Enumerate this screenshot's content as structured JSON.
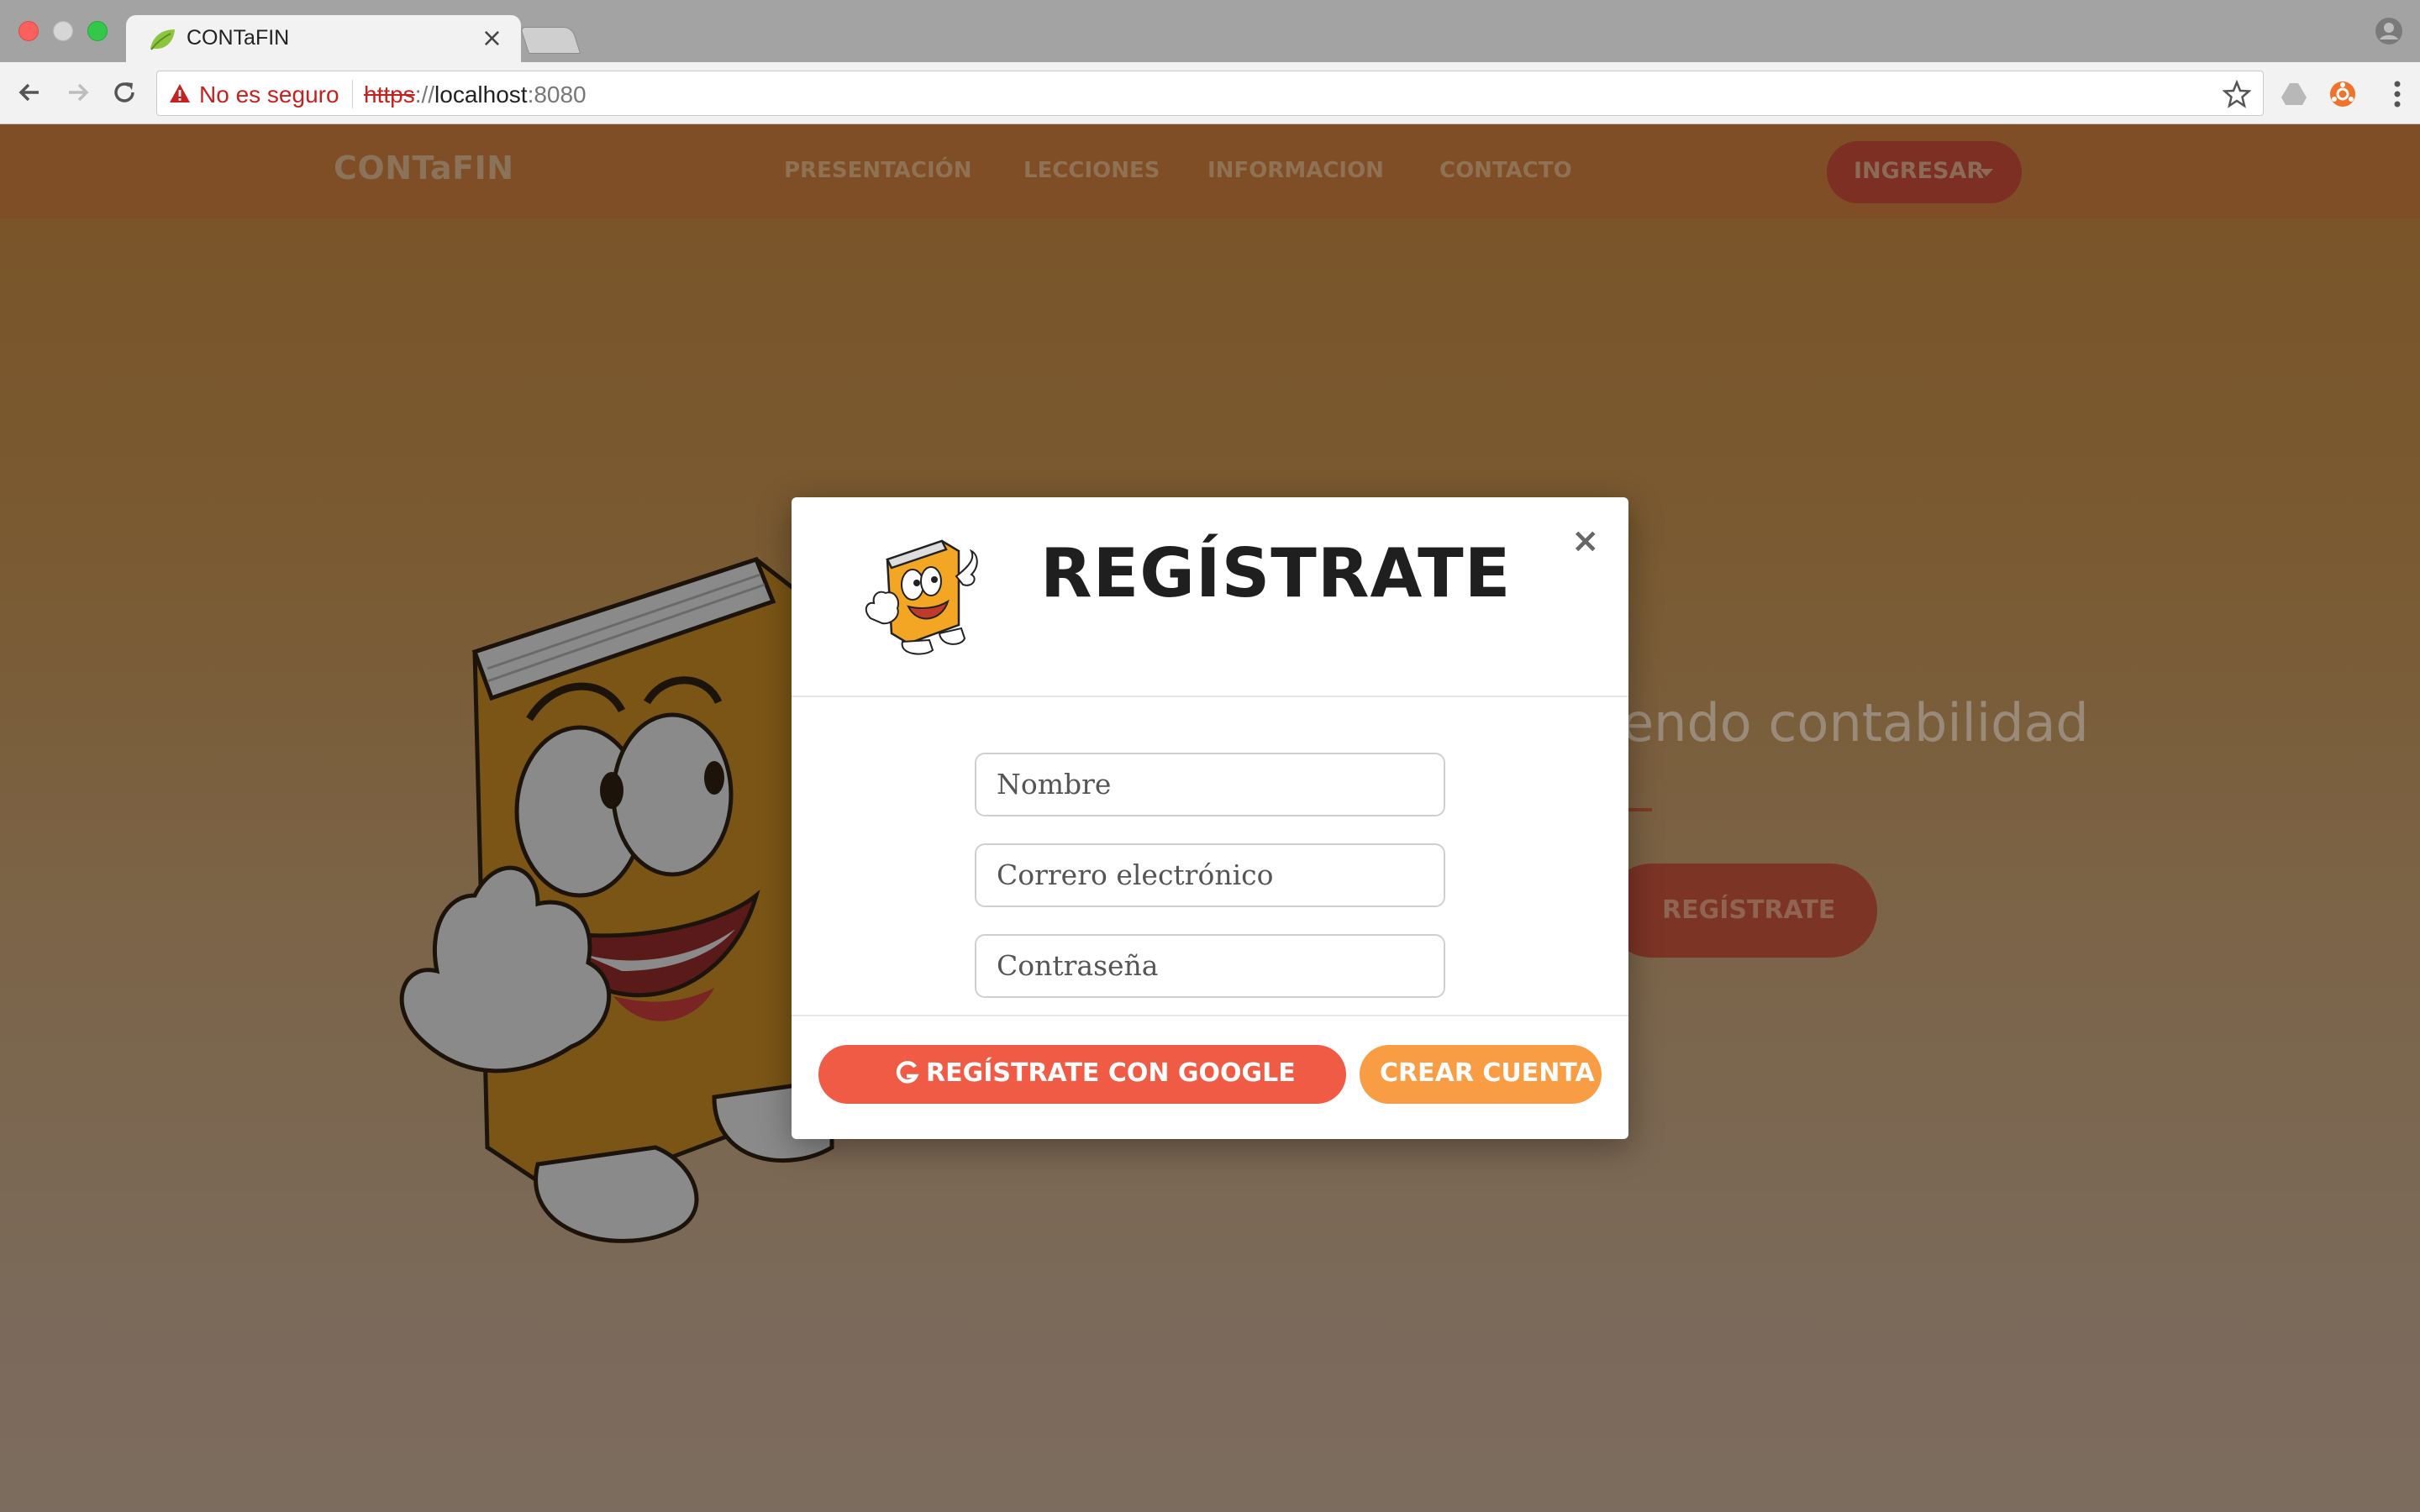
{
  "browser": {
    "tab_title": "CONTaFIN",
    "tab_close": "×",
    "security_label": "No es seguro",
    "url_scheme": "https",
    "url_sep": "://",
    "url_host": "localhost",
    "url_port": ":8080"
  },
  "site": {
    "brand": "CONTaFIN",
    "nav": [
      "PRESENTACIÓN",
      "LECCIONES",
      "INFORMACION",
      "CONTACTO"
    ],
    "login_button": "INGRESAR",
    "hero_text": "endo contabilidad",
    "hero_button": "REGÍSTRATE"
  },
  "modal": {
    "title": "REGÍSTRATE",
    "close": "×",
    "fields": {
      "name_placeholder": "Nombre",
      "email_placeholder": "Correro electrónico",
      "password_placeholder": "Contraseña"
    },
    "google_button": "REGÍSTRATE CON GOOGLE",
    "create_button": "CREAR CUENTA"
  },
  "colors": {
    "accent_red": "#ef5b45",
    "accent_orange": "#f99d44",
    "insecure_red": "#c5221f"
  }
}
